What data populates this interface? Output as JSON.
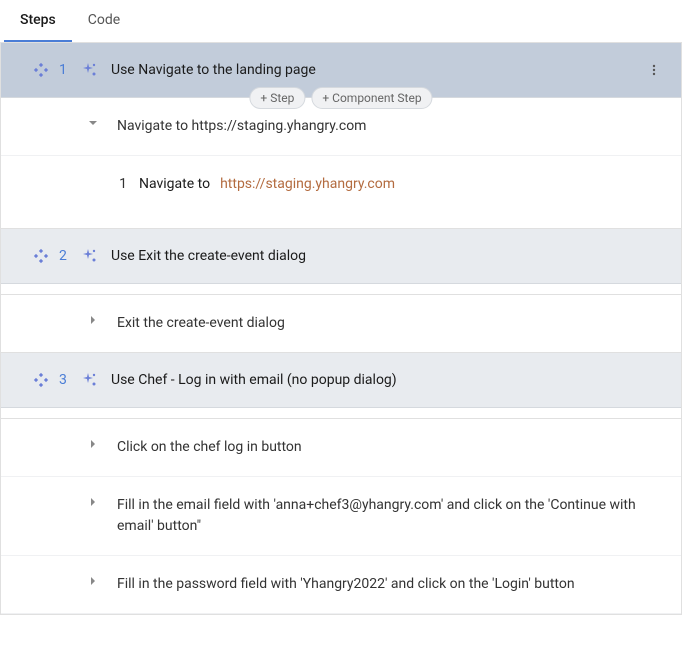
{
  "tabs": {
    "steps": "Steps",
    "code": "Code"
  },
  "pills": {
    "add_step": "+ Step",
    "add_component": "+ Component Step"
  },
  "steps": [
    {
      "num": "1",
      "title": "Use Navigate to the landing page",
      "sub": [
        {
          "text": "Navigate to https://staging.yhangry.com",
          "expanded": true
        }
      ],
      "action": {
        "num": "1",
        "label": "Navigate to",
        "url": "https://staging.yhangry.com"
      }
    },
    {
      "num": "2",
      "title": "Use Exit the create-event dialog",
      "sub": [
        {
          "text": "Exit the create-event dialog",
          "expanded": false
        }
      ]
    },
    {
      "num": "3",
      "title": "Use Chef - Log in with email (no popup dialog)",
      "sub": [
        {
          "text": "Click on the chef log in button",
          "expanded": false
        },
        {
          "text": "Fill in the email field with 'anna+chef3@yhangry.com' and click on the 'Continue with email' button\"",
          "expanded": false
        },
        {
          "text": "Fill in the password field with 'Yhangry2022' and click on the 'Login' button",
          "expanded": false
        }
      ]
    }
  ]
}
